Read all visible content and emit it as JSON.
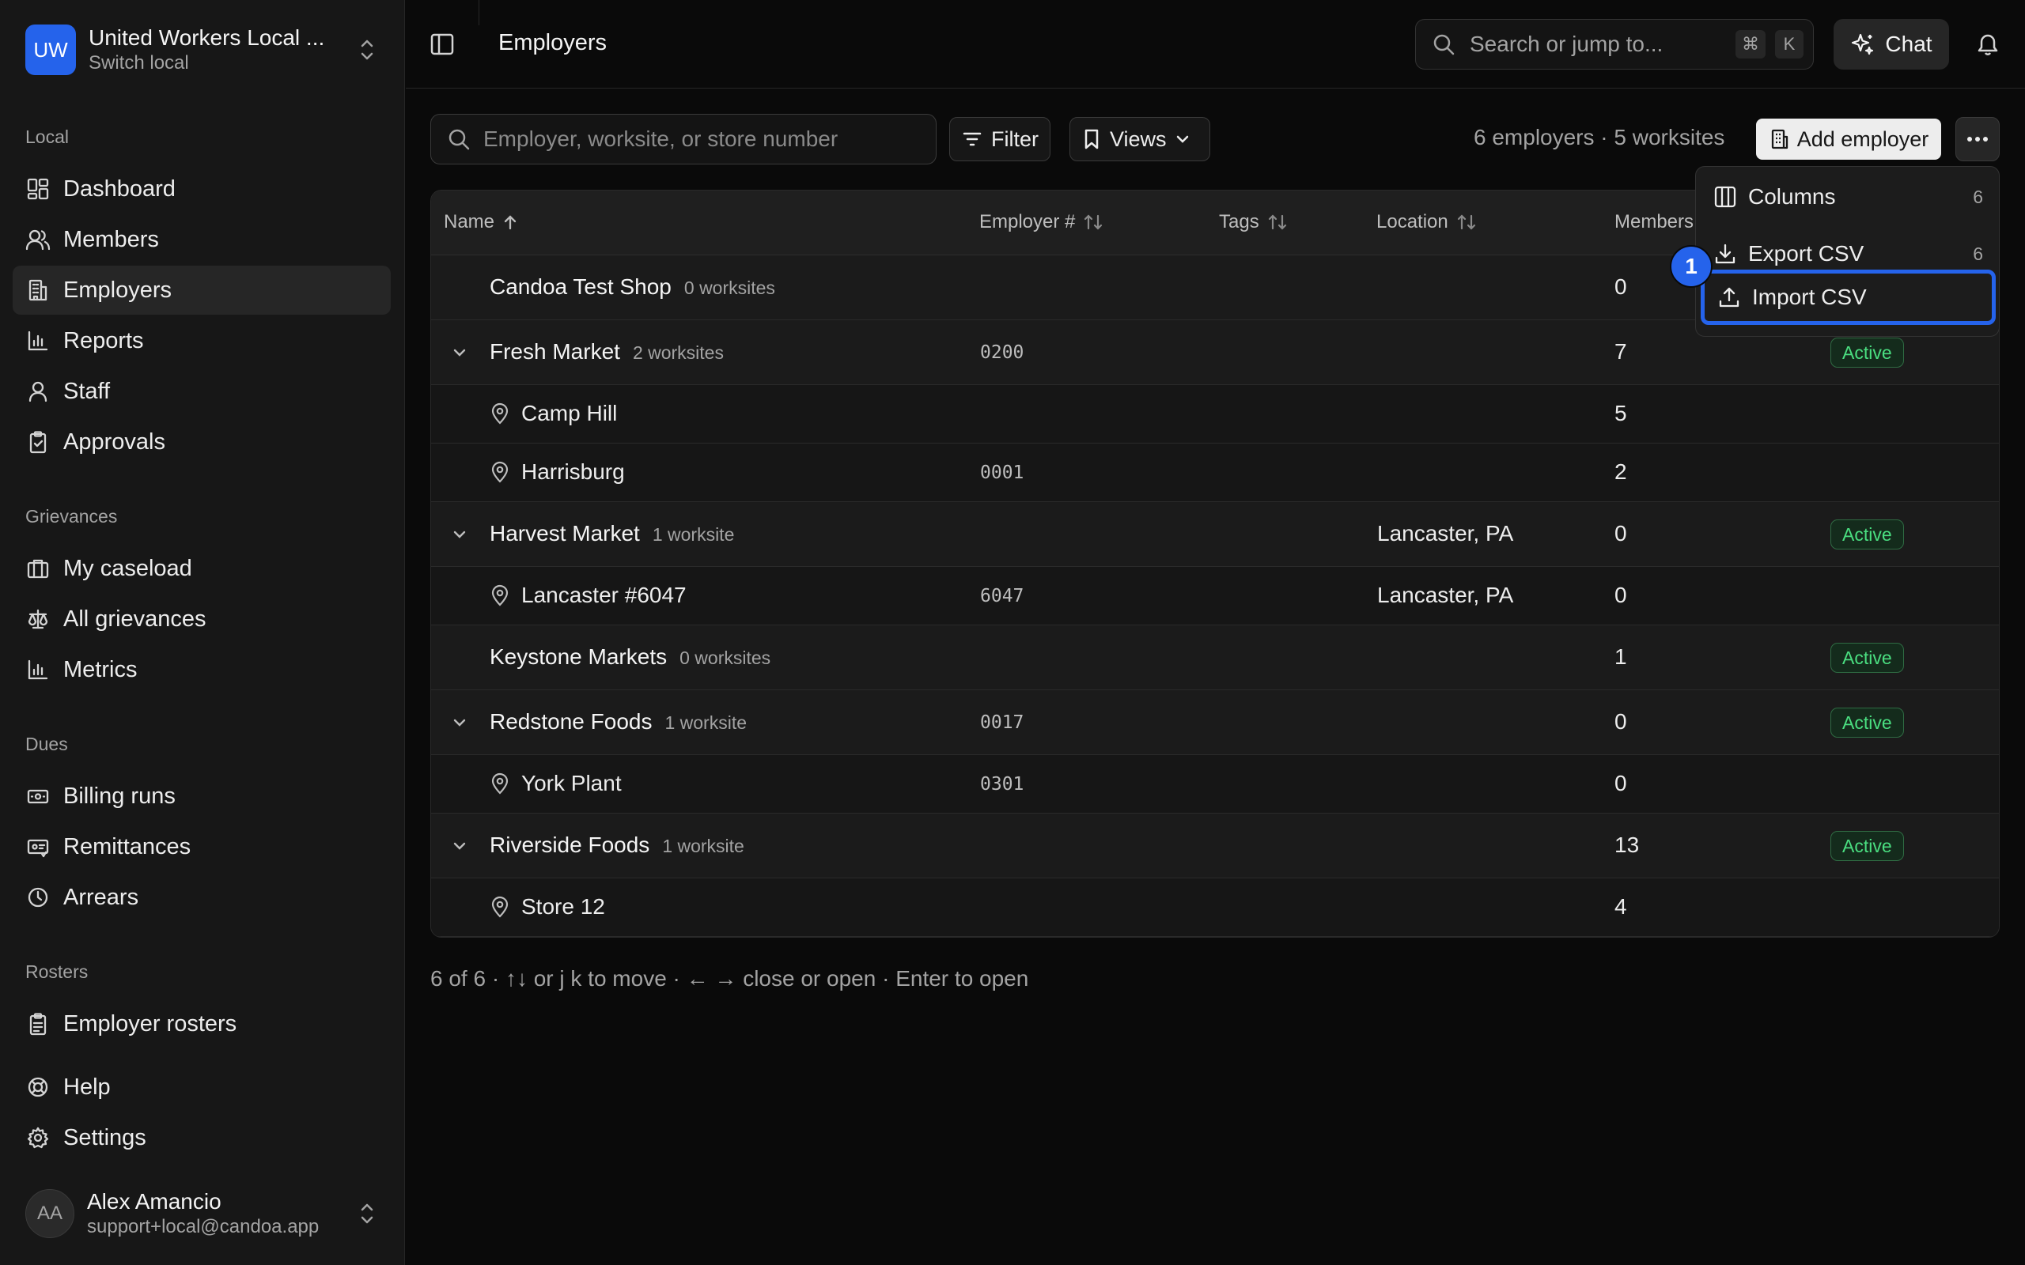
{
  "org": {
    "initials": "UW",
    "name": "United Workers Local ...",
    "sub": "Switch local"
  },
  "sidebar": {
    "sections": [
      {
        "label": "Local",
        "items": [
          {
            "label": "Dashboard",
            "icon": "dashboard-icon"
          },
          {
            "label": "Members",
            "icon": "members-icon"
          },
          {
            "label": "Employers",
            "icon": "building-icon",
            "active": true
          },
          {
            "label": "Reports",
            "icon": "bar-chart-icon"
          },
          {
            "label": "Staff",
            "icon": "user-icon"
          },
          {
            "label": "Approvals",
            "icon": "clipboard-check-icon"
          }
        ]
      },
      {
        "label": "Grievances",
        "items": [
          {
            "label": "My caseload",
            "icon": "briefcase-icon"
          },
          {
            "label": "All grievances",
            "icon": "scale-icon"
          },
          {
            "label": "Metrics",
            "icon": "bar-chart-icon"
          }
        ]
      },
      {
        "label": "Dues",
        "items": [
          {
            "label": "Billing runs",
            "icon": "banknote-icon"
          },
          {
            "label": "Remittances",
            "icon": "receipt-icon"
          },
          {
            "label": "Arrears",
            "icon": "clock-icon"
          }
        ]
      },
      {
        "label": "Rosters",
        "items": [
          {
            "label": "Employer rosters",
            "icon": "clipboard-list-icon"
          }
        ]
      }
    ],
    "bottom": [
      {
        "label": "Help",
        "icon": "life-buoy-icon"
      },
      {
        "label": "Settings",
        "icon": "gear-icon"
      }
    ]
  },
  "user": {
    "initials": "AA",
    "name": "Alex Amancio",
    "email": "support+local@candoa.app"
  },
  "topbar": {
    "title": "Employers",
    "search_placeholder": "Search or jump to...",
    "kbd_cmd": "⌘",
    "kbd_k": "K",
    "chat_label": "Chat"
  },
  "toolbar": {
    "search_placeholder": "Employer, worksite, or store number",
    "filter_label": "Filter",
    "views_label": "Views",
    "counts": "6 employers · 5 worksites",
    "add_label": "Add employer"
  },
  "table": {
    "columns": {
      "name": "Name",
      "employer_no": "Employer #",
      "tags": "Tags",
      "location": "Location",
      "members": "Members"
    },
    "rows": [
      {
        "kind": "parent",
        "name": "Candoa Test Shop",
        "worksites": "0 worksites",
        "expandable": false,
        "number": "",
        "location": "",
        "members": "0",
        "status": ""
      },
      {
        "kind": "parent",
        "name": "Fresh Market",
        "worksites": "2 worksites",
        "expandable": true,
        "number": "0200",
        "location": "",
        "members": "7",
        "status": "Active"
      },
      {
        "kind": "child",
        "name": "Camp Hill",
        "number": "",
        "location": "",
        "members": "5"
      },
      {
        "kind": "child",
        "name": "Harrisburg",
        "number": "0001",
        "location": "",
        "members": "2"
      },
      {
        "kind": "parent",
        "name": "Harvest Market",
        "worksites": "1 worksite",
        "expandable": true,
        "number": "",
        "location": "Lancaster, PA",
        "members": "0",
        "status": "Active"
      },
      {
        "kind": "child",
        "name": "Lancaster #6047",
        "number": "6047",
        "location": "Lancaster, PA",
        "members": "0"
      },
      {
        "kind": "parent",
        "name": "Keystone Markets",
        "worksites": "0 worksites",
        "expandable": false,
        "number": "",
        "location": "",
        "members": "1",
        "status": "Active"
      },
      {
        "kind": "parent",
        "name": "Redstone Foods",
        "worksites": "1 worksite",
        "expandable": true,
        "number": "0017",
        "location": "",
        "members": "0",
        "status": "Active"
      },
      {
        "kind": "child",
        "name": "York Plant",
        "number": "0301",
        "location": "",
        "members": "0"
      },
      {
        "kind": "parent",
        "name": "Riverside Foods",
        "worksites": "1 worksite",
        "expandable": true,
        "number": "",
        "location": "",
        "members": "13",
        "status": "Active"
      },
      {
        "kind": "child",
        "name": "Store 12",
        "number": "",
        "location": "",
        "members": "4"
      }
    ]
  },
  "footnote": "6 of 6 · ↑↓ or j k to move · ← → close or open · Enter to open",
  "menu": {
    "items": [
      {
        "label": "Columns",
        "count": "6",
        "icon": "columns-icon"
      },
      {
        "label": "Export CSV",
        "count": "6",
        "icon": "download-icon"
      },
      {
        "label": "Import CSV",
        "count": "",
        "icon": "upload-icon",
        "focused": true
      }
    ],
    "step_marker": "1"
  },
  "colors": {
    "accent": "#2563eb",
    "status_active": "#4ade80",
    "background": "#0a0a0a",
    "sidebar": "#171717"
  }
}
